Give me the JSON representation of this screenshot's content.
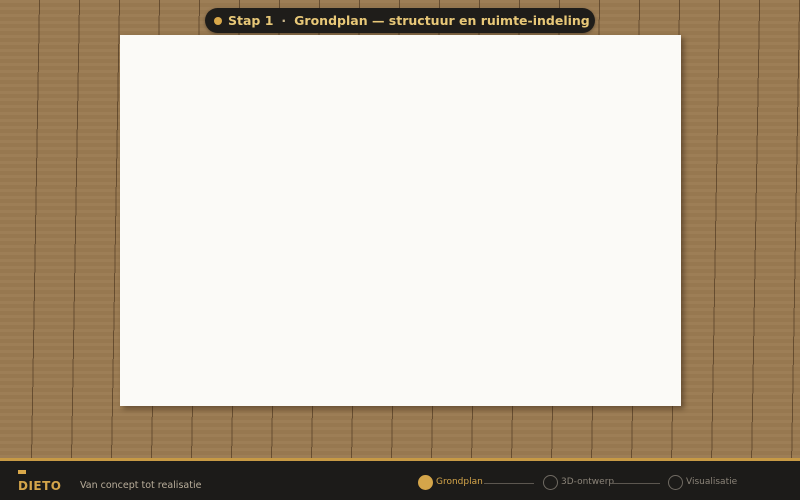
{
  "step_pill": {
    "step": "Stap 1",
    "separator": "·",
    "title": "Grondplan — structuur en ruimte-indeling"
  },
  "footer": {
    "brand": "DIETO",
    "tagline": "Van concept tot realisatie",
    "steps": [
      {
        "label": "Grondplan",
        "state": "active"
      },
      {
        "label": "3D-ontwerp",
        "state": "inactive"
      },
      {
        "label": "Visualisatie",
        "state": "inactive"
      }
    ]
  },
  "colors": {
    "accent": "#d4a54a",
    "floor": "#9a7a52",
    "footer_bg": "#1c1b19",
    "paper": "#fbfaf7"
  }
}
